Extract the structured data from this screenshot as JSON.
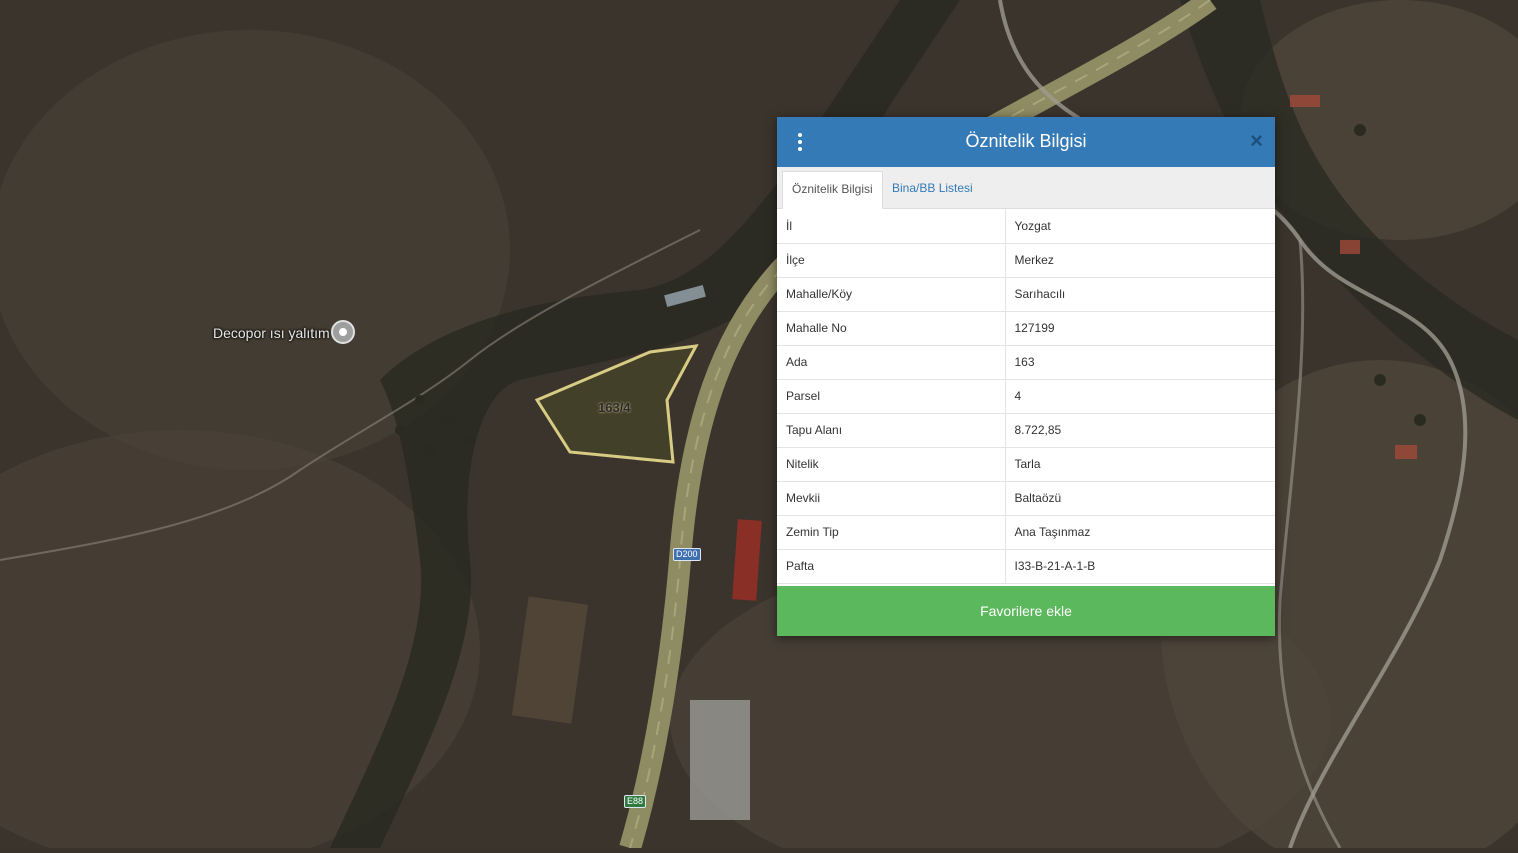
{
  "map": {
    "poi_label": "Decopor ısı yalıtım",
    "parcel_label": "163/4",
    "road_shield_1": "D200",
    "road_shield_2": "E88"
  },
  "panel": {
    "title": "Öznitelik Bilgisi",
    "close_label": "×",
    "tabs": [
      {
        "label": "Öznitelik Bilgisi",
        "active": true
      },
      {
        "label": "Bina/BB Listesi",
        "active": false
      }
    ],
    "rows": [
      {
        "key": "İl",
        "value": "Yozgat"
      },
      {
        "key": "İlçe",
        "value": "Merkez"
      },
      {
        "key": "Mahalle/Köy",
        "value": "Sarıhacılı"
      },
      {
        "key": "Mahalle No",
        "value": "127199"
      },
      {
        "key": "Ada",
        "value": "163"
      },
      {
        "key": "Parsel",
        "value": "4"
      },
      {
        "key": "Tapu Alanı",
        "value": "8.722,85"
      },
      {
        "key": "Nitelik",
        "value": "Tarla"
      },
      {
        "key": "Mevkii",
        "value": "Baltaözü"
      },
      {
        "key": "Zemin Tip",
        "value": "Ana Taşınmaz"
      },
      {
        "key": "Pafta",
        "value": "I33-B-21-A-1-B"
      }
    ],
    "favorite_button": "Favorilere ekle"
  },
  "colors": {
    "header": "#337ab7",
    "button": "#5cb85c",
    "parcel_outline": "#d8cc84"
  }
}
